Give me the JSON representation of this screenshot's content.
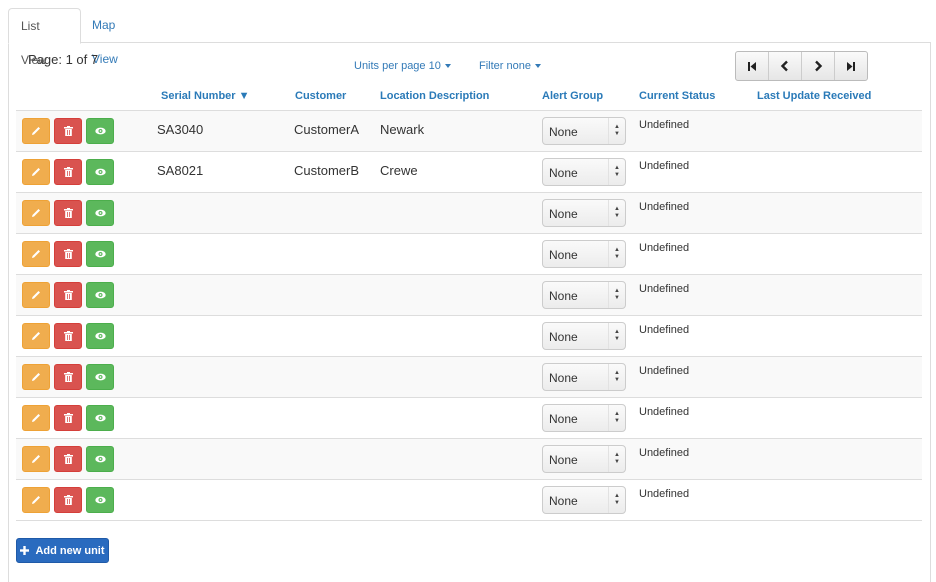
{
  "tabs": [
    {
      "label": "List View",
      "active": true
    },
    {
      "label": "Map View",
      "active": false
    }
  ],
  "pagination": {
    "page_label": "Page: 1 of 7",
    "units_per_page": "Units per page 10",
    "filter": "Filter none",
    "buttons": [
      "first-page-icon",
      "previous-page-icon",
      "next-page-icon",
      "last-page-icon"
    ]
  },
  "table": {
    "headers": {
      "serial": "Serial Number ▼",
      "customer": "Customer",
      "location": "Location Description",
      "alert": "Alert Group",
      "status": "Current Status",
      "update": "Last Update Received"
    },
    "rows": [
      {
        "serial": "SA3040",
        "customer": "CustomerA",
        "location": "Newark",
        "alert": "None",
        "status": "Undefined",
        "update": ""
      },
      {
        "serial": "SA8021",
        "customer": "CustomerB",
        "location": "Crewe",
        "alert": "None",
        "status": "Undefined",
        "update": ""
      },
      {
        "serial": "",
        "customer": "",
        "location": "",
        "alert": "None",
        "status": "Undefined",
        "update": ""
      },
      {
        "serial": "",
        "customer": "",
        "location": "",
        "alert": "None",
        "status": "Undefined",
        "update": ""
      },
      {
        "serial": "",
        "customer": "",
        "location": "",
        "alert": "None",
        "status": "Undefined",
        "update": ""
      },
      {
        "serial": "",
        "customer": "",
        "location": "",
        "alert": "None",
        "status": "Undefined",
        "update": ""
      },
      {
        "serial": "",
        "customer": "",
        "location": "",
        "alert": "None",
        "status": "Undefined",
        "update": ""
      },
      {
        "serial": "",
        "customer": "",
        "location": "",
        "alert": "None",
        "status": "Undefined",
        "update": ""
      },
      {
        "serial": "",
        "customer": "",
        "location": "",
        "alert": "None",
        "status": "Undefined",
        "update": ""
      },
      {
        "serial": "",
        "customer": "",
        "location": "",
        "alert": "None",
        "status": "Undefined",
        "update": ""
      }
    ],
    "row_actions": [
      "pencil-icon",
      "trash-icon",
      "eye-icon"
    ]
  },
  "add_button": {
    "label": "Add new unit",
    "icon": "plus-icon"
  },
  "colors": {
    "link": "#337ab7",
    "header": "#2a7ab8",
    "edit": "#f0ad4e",
    "delete": "#d9534f",
    "view": "#5cb85c",
    "primary": "#2a6bbf"
  }
}
